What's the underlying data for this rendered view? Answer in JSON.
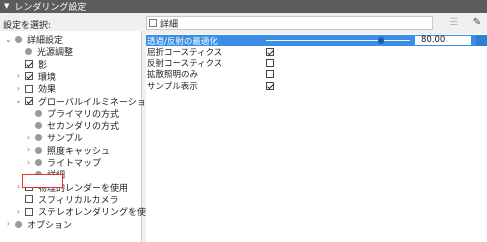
{
  "header": {
    "title": "レンダリング設定"
  },
  "left": {
    "settings_label": "設定を選択:",
    "tree": [
      {
        "label": "詳細設定",
        "chevron": "down",
        "mark": "dot",
        "checked": false,
        "indent": 0
      },
      {
        "label": "光源調整",
        "chevron": "",
        "mark": "dot",
        "checked": false,
        "indent": 1
      },
      {
        "label": "影",
        "chevron": "",
        "mark": "checkbox",
        "checked": true,
        "indent": 1
      },
      {
        "label": "環境",
        "chevron": "right",
        "mark": "checkbox",
        "checked": true,
        "indent": 1
      },
      {
        "label": "効果",
        "chevron": "right",
        "mark": "checkbox",
        "checked": false,
        "indent": 1
      },
      {
        "label": "グローバルイルミネーション",
        "chevron": "down",
        "mark": "checkbox",
        "checked": true,
        "indent": 1
      },
      {
        "label": "プライマリの方式",
        "chevron": "",
        "mark": "dot",
        "checked": false,
        "indent": 2
      },
      {
        "label": "セカンダリの方式",
        "chevron": "",
        "mark": "dot",
        "checked": false,
        "indent": 2
      },
      {
        "label": "サンプル",
        "chevron": "right",
        "mark": "dot",
        "checked": false,
        "indent": 2
      },
      {
        "label": "照度キャッシュ",
        "chevron": "right",
        "mark": "dot",
        "checked": false,
        "indent": 2
      },
      {
        "label": "ライトマップ",
        "chevron": "right",
        "mark": "dot",
        "checked": false,
        "indent": 2
      },
      {
        "label": "詳細",
        "chevron": "",
        "mark": "dot",
        "checked": false,
        "indent": 2
      },
      {
        "label": "物理的レンダーを使用",
        "chevron": "right",
        "mark": "checkbox",
        "checked": false,
        "indent": 1
      },
      {
        "label": "スフィリカルカメラ",
        "chevron": "",
        "mark": "checkbox",
        "checked": false,
        "indent": 1
      },
      {
        "label": "ステレオレンダリングを使用",
        "chevron": "right",
        "mark": "checkbox",
        "checked": false,
        "indent": 1
      },
      {
        "label": "オプション",
        "chevron": "right",
        "mark": "dot",
        "checked": false,
        "indent": 0
      }
    ]
  },
  "right": {
    "title_value": "詳細",
    "properties": [
      {
        "label": "透過/反射の最適化",
        "kind": "slider",
        "value": "80.00",
        "selected": true
      },
      {
        "label": "屈折コースティクス",
        "kind": "checkbox",
        "checked": true,
        "selected": false
      },
      {
        "label": "反射コースティクス",
        "kind": "checkbox",
        "checked": false,
        "selected": false
      },
      {
        "label": "拡散照明のみ",
        "kind": "checkbox",
        "checked": false,
        "selected": false
      },
      {
        "label": "サンプル表示",
        "kind": "checkbox",
        "checked": true,
        "selected": false
      }
    ],
    "slider_level": 0.8
  },
  "toolbar": {
    "left_icon": "list-filter-icon",
    "right_icon": "edit-icon"
  },
  "colors": {
    "header_bg": "#5c5c5c",
    "selection": "#3a8ee6",
    "highlight": "#e3312b"
  }
}
